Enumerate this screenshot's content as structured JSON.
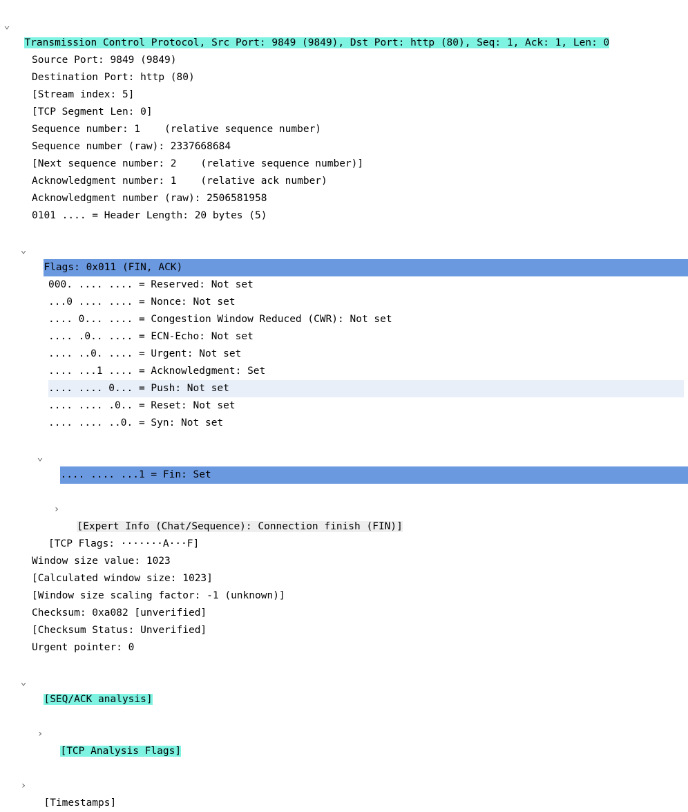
{
  "header": "Transmission Control Protocol, Src Port: 9849 (9849), Dst Port: http (80), Seq: 1, Ack: 1, Len: 0",
  "srcPort": "Source Port: 9849 (9849)",
  "dstPort": "Destination Port: http (80)",
  "streamIndex": "[Stream index: 5]",
  "tcpSegLen": "[TCP Segment Len: 0]",
  "seqNum": "Sequence number: 1    (relative sequence number)",
  "seqNumRaw": "Sequence number (raw): 2337668684",
  "nextSeq": "[Next sequence number: 2    (relative sequence number)]",
  "ackNum": "Acknowledgment number: 1    (relative ack number)",
  "ackNumRaw": "Acknowledgment number (raw): 2506581958",
  "hdrLen": "0101 .... = Header Length: 20 bytes (5)",
  "flagsHeader": "Flags: 0x011 (FIN, ACK)",
  "flag_reserved": "000. .... .... = Reserved: Not set",
  "flag_nonce": "...0 .... .... = Nonce: Not set",
  "flag_cwr": ".... 0... .... = Congestion Window Reduced (CWR): Not set",
  "flag_ecn": ".... .0.. .... = ECN-Echo: Not set",
  "flag_urg": ".... ..0. .... = Urgent: Not set",
  "flag_ack": ".... ...1 .... = Acknowledgment: Set",
  "flag_push": ".... .... 0... = Push: Not set",
  "flag_reset": ".... .... .0.. = Reset: Not set",
  "flag_syn": ".... .... ..0. = Syn: Not set",
  "flag_fin": ".... .... ...1 = Fin: Set",
  "expertInfo": "[Expert Info (Chat/Sequence): Connection finish (FIN)]",
  "tcpFlagsStr": "[TCP Flags: ·······A···F]",
  "winSize": "Window size value: 1023",
  "calcWinSize": "[Calculated window size: 1023]",
  "winScale": "[Window size scaling factor: -1 (unknown)]",
  "checksum": "Checksum: 0xa082 [unverified]",
  "checksumStatus": "[Checksum Status: Unverified]",
  "urgentPtr": "Urgent pointer: 0",
  "seqAckAnalysis": "[SEQ/ACK analysis]",
  "tcpAnalysisFlags": "[TCP Analysis Flags]",
  "timestamps": "[Timestamps]",
  "glyph_down": "⌄",
  "glyph_right": "›"
}
